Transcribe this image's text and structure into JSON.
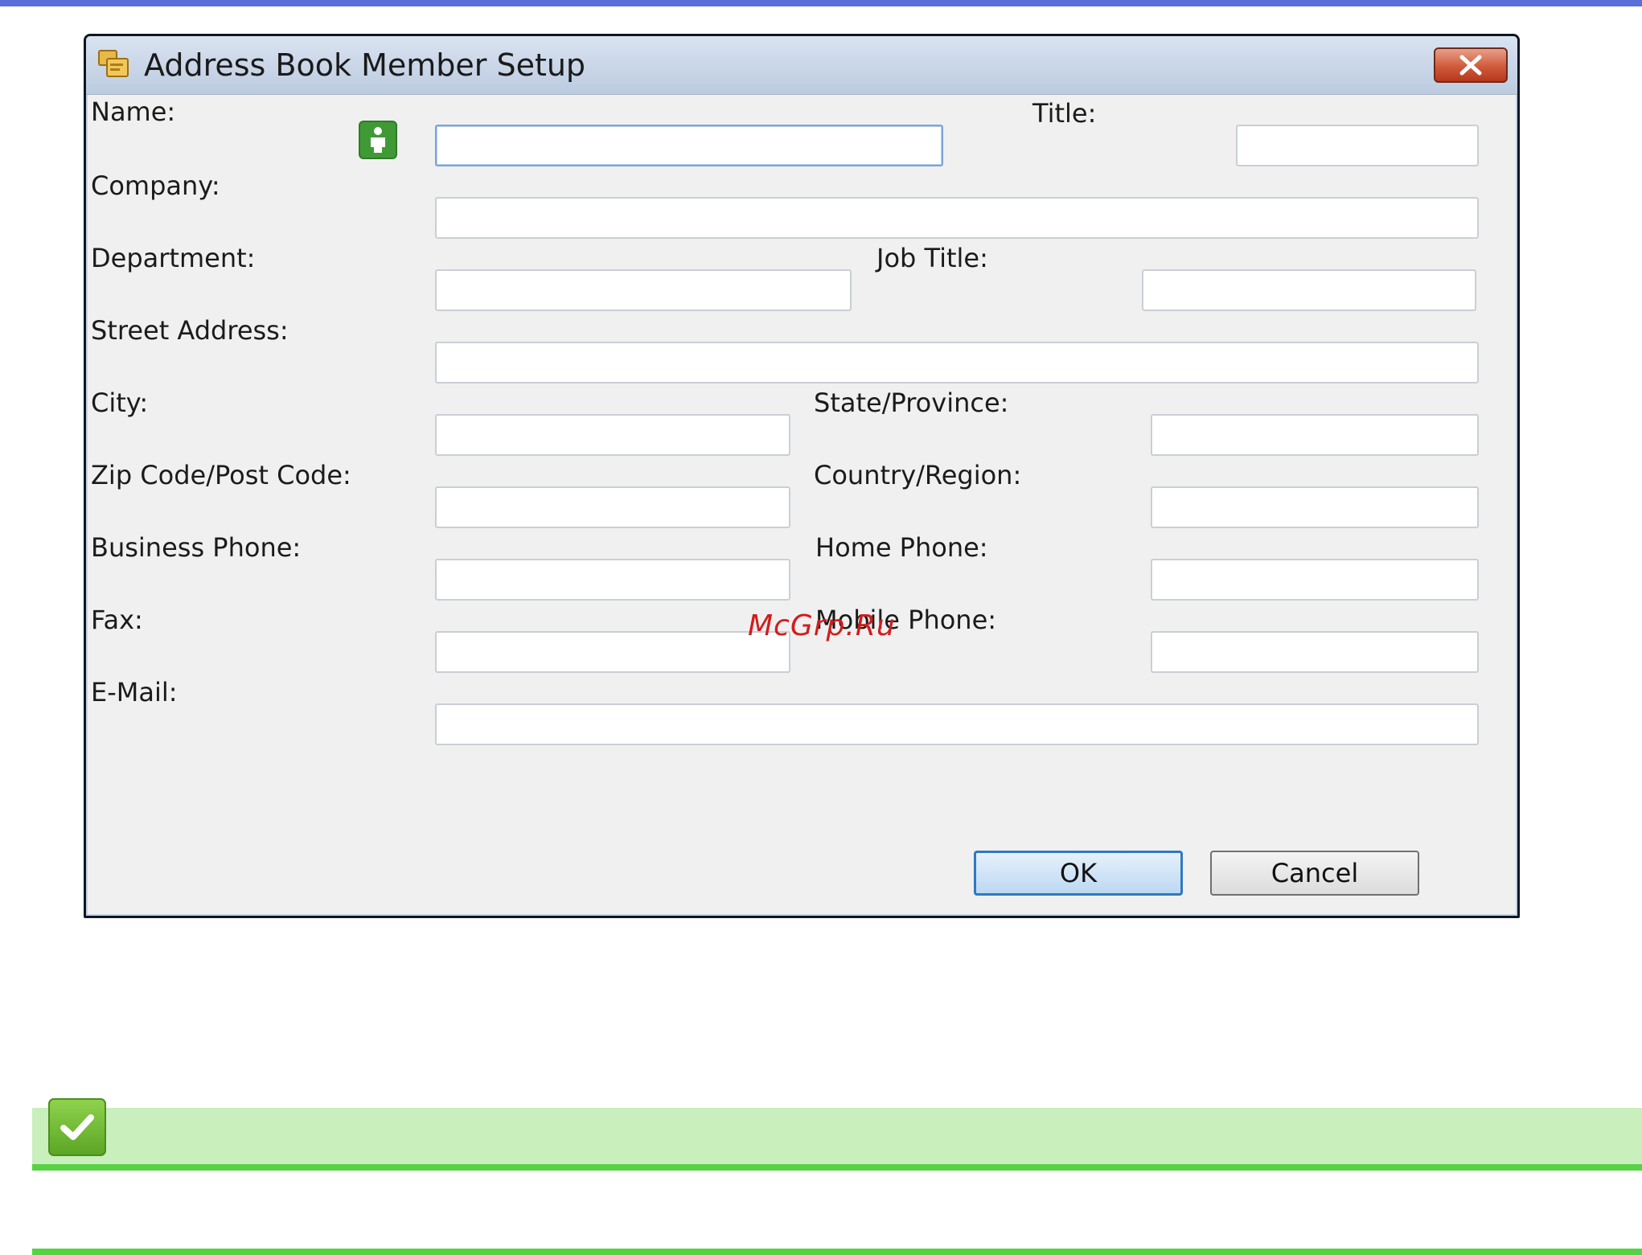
{
  "dialog": {
    "title": "Address Book Member Setup",
    "icons": {
      "app": "address-book-icon",
      "close": "close-icon",
      "person": "person-icon"
    },
    "fields": {
      "name": {
        "label": "Name:",
        "value": ""
      },
      "title": {
        "label": "Title:",
        "value": ""
      },
      "company": {
        "label": "Company:",
        "value": ""
      },
      "department": {
        "label": "Department:",
        "value": ""
      },
      "job_title": {
        "label": "Job Title:",
        "value": ""
      },
      "street_address": {
        "label": "Street Address:",
        "value": ""
      },
      "city": {
        "label": "City:",
        "value": ""
      },
      "state_province": {
        "label": "State/Province:",
        "value": ""
      },
      "zip_code": {
        "label": "Zip Code/Post Code:",
        "value": ""
      },
      "country_region": {
        "label": "Country/Region:",
        "value": ""
      },
      "business_phone": {
        "label": "Business Phone:",
        "value": ""
      },
      "home_phone": {
        "label": "Home Phone:",
        "value": ""
      },
      "fax": {
        "label": "Fax:",
        "value": ""
      },
      "mobile_phone": {
        "label": "Mobile Phone:",
        "value": ""
      },
      "email": {
        "label": "E-Mail:",
        "value": ""
      }
    },
    "buttons": {
      "ok": "OK",
      "cancel": "Cancel"
    }
  },
  "watermark": "McGrp.Ru",
  "note": {
    "icon": "checkmark-icon"
  },
  "colors": {
    "top_bar": "#5b6fd8",
    "note_band": "#c9efbc",
    "note_line": "#57d244",
    "close_button": "#cf5a3c",
    "person_icon": "#3f9a36",
    "watermark": "#d21c1c"
  }
}
